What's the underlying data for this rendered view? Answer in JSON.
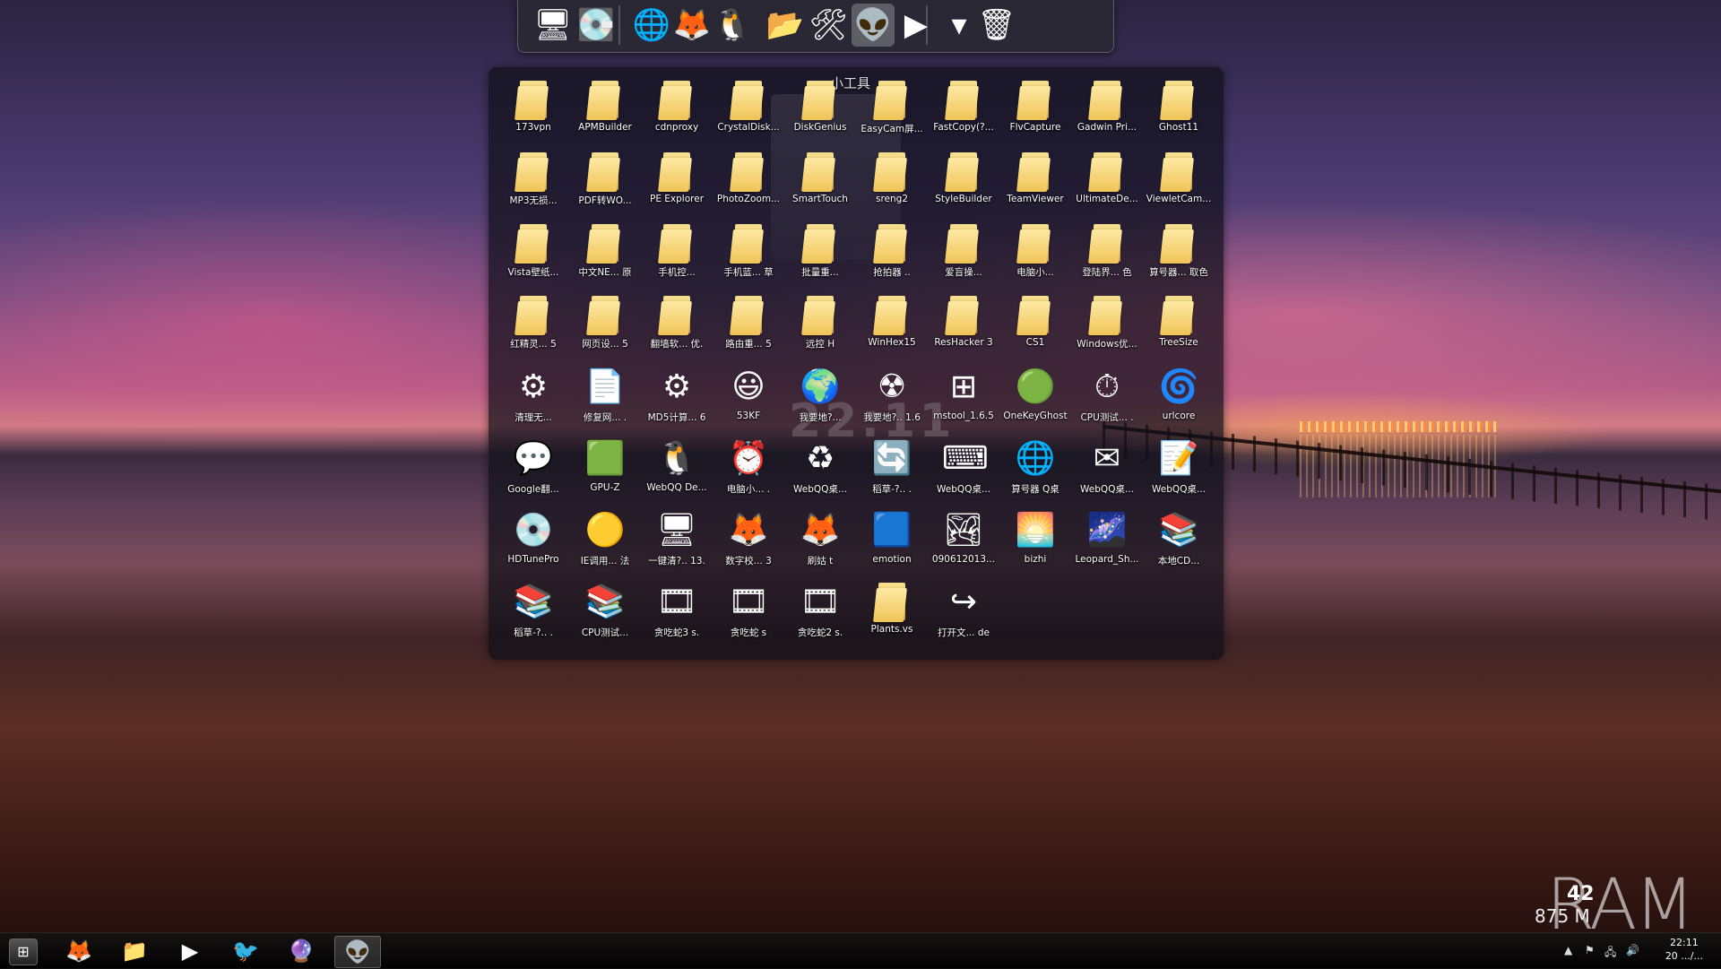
{
  "dock": {
    "items": [
      {
        "name": "computer-icon",
        "glyph": "🖥"
      },
      {
        "name": "disk-cleanup-icon",
        "glyph": "💽"
      },
      {
        "name": "internet-globe-icon",
        "glyph": "🌐"
      },
      {
        "name": "firefox-icon",
        "glyph": "🦊"
      },
      {
        "name": "qq-penguin-icon",
        "glyph": "🐧"
      },
      {
        "name": "download-folder-icon",
        "glyph": "📂"
      },
      {
        "name": "tools-icon",
        "glyph": "🛠"
      },
      {
        "name": "alien-icon",
        "glyph": "👽"
      },
      {
        "name": "media-player-icon",
        "glyph": "▶"
      },
      {
        "name": "dropdown-icon",
        "glyph": "▾"
      },
      {
        "name": "recycle-bin-icon",
        "glyph": "🗑"
      }
    ]
  },
  "panel": {
    "title": "小工具",
    "clock_ghost": "22:11",
    "items": [
      {
        "label": "173vpn",
        "type": "folder"
      },
      {
        "label": "APMBuilder",
        "type": "folder"
      },
      {
        "label": "cdnproxy",
        "type": "folder"
      },
      {
        "label": "CrystalDisk...",
        "type": "folder"
      },
      {
        "label": "DiskGenius",
        "type": "folder"
      },
      {
        "label": "EasyCam屏...",
        "type": "folder"
      },
      {
        "label": "FastCopy(?...",
        "type": "folder"
      },
      {
        "label": "FlvCapture",
        "type": "folder"
      },
      {
        "label": "Gadwin Pri...",
        "type": "folder"
      },
      {
        "label": "Ghost11",
        "type": "folder"
      },
      {
        "label": "MP3无损...",
        "type": "folder"
      },
      {
        "label": "PDF转WO...",
        "type": "folder"
      },
      {
        "label": "PE Explorer",
        "type": "folder"
      },
      {
        "label": "PhotoZoom...",
        "type": "folder"
      },
      {
        "label": "SmartTouch",
        "type": "folder"
      },
      {
        "label": "sreng2",
        "type": "folder"
      },
      {
        "label": "StyleBuilder",
        "type": "folder"
      },
      {
        "label": "TeamViewer",
        "type": "folder"
      },
      {
        "label": "UltimateDe...",
        "type": "folder"
      },
      {
        "label": "ViewletCam...",
        "type": "folder"
      },
      {
        "label": "Vista壁纸...",
        "type": "folder"
      },
      {
        "label": "中文NE... 原",
        "type": "folder"
      },
      {
        "label": "手机控...",
        "type": "folder"
      },
      {
        "label": "手机蓝... 草",
        "type": "folder"
      },
      {
        "label": "批量重...",
        "type": "folder"
      },
      {
        "label": "抢拍器 ..",
        "type": "folder"
      },
      {
        "label": "爱盲操...",
        "type": "folder"
      },
      {
        "label": "电脑小...",
        "type": "folder"
      },
      {
        "label": "登陆界... 色",
        "type": "folder"
      },
      {
        "label": "算号器... 取色",
        "type": "folder"
      },
      {
        "label": "红精灵... 5",
        "type": "folder"
      },
      {
        "label": "网页设... 5",
        "type": "folder"
      },
      {
        "label": "翻墙软... 优.",
        "type": "folder"
      },
      {
        "label": "路由重... 5",
        "type": "folder"
      },
      {
        "label": "远控 H",
        "type": "folder"
      },
      {
        "label": "WinHex15",
        "type": "folder"
      },
      {
        "label": "ResHacker 3",
        "type": "folder"
      },
      {
        "label": "CS1",
        "type": "folder"
      },
      {
        "label": "Windows优...",
        "type": "folder"
      },
      {
        "label": "TreeSize",
        "type": "folder"
      },
      {
        "label": "清理无...",
        "type": "app",
        "icon": "settings-app-icon",
        "glyph": "⚙"
      },
      {
        "label": "修复网... .",
        "type": "app",
        "icon": "document-gear-icon",
        "glyph": "📄"
      },
      {
        "label": "MD5计算... 6",
        "type": "app",
        "icon": "gears-icon",
        "glyph": "⚙"
      },
      {
        "label": "53KF",
        "type": "app",
        "icon": "smiley-icon",
        "glyph": "😃"
      },
      {
        "label": "我要地?...",
        "type": "app",
        "icon": "globe-stand-icon",
        "glyph": "🌍"
      },
      {
        "label": "我要地?.. 1.6",
        "type": "app",
        "icon": "radiation-icon",
        "glyph": "☢"
      },
      {
        "label": "mstool_1.6.5",
        "type": "app",
        "icon": "windows-logo-icon",
        "glyph": "⊞"
      },
      {
        "label": "OneKeyGhost",
        "type": "app",
        "icon": "green-ghost-icon",
        "glyph": "🟢"
      },
      {
        "label": "CPU测试... .",
        "type": "app",
        "icon": "stopwatch-icon",
        "glyph": "⏱"
      },
      {
        "label": "urlcore",
        "type": "app",
        "icon": "blue-swirl-icon",
        "glyph": "🌀"
      },
      {
        "label": "Google翻...",
        "type": "app",
        "icon": "chat-bubbles-icon",
        "glyph": "💬"
      },
      {
        "label": "GPU-Z",
        "type": "app",
        "icon": "graphics-card-icon",
        "glyph": "🟩"
      },
      {
        "label": "WebQQ De...",
        "type": "app",
        "icon": "qq-penguin-icon",
        "glyph": "🐧"
      },
      {
        "label": "电脑小... .",
        "type": "app",
        "icon": "alarm-clock-icon",
        "glyph": "⏰"
      },
      {
        "label": "WebQQ桌...",
        "type": "app",
        "icon": "recycle-icon",
        "glyph": "♻"
      },
      {
        "label": "稻草-?.. .",
        "type": "app",
        "icon": "teamviewer-icon",
        "glyph": "🔄"
      },
      {
        "label": "WebQQ桌...",
        "type": "app",
        "icon": "keyboard-globe-icon",
        "glyph": "⌨"
      },
      {
        "label": "算号器 Q桌",
        "type": "app",
        "icon": "globe-star-icon",
        "glyph": "🌐"
      },
      {
        "label": "WebQQ桌...",
        "type": "app",
        "icon": "envelope-icon",
        "glyph": "✉"
      },
      {
        "label": "WebQQ桌...",
        "type": "app",
        "icon": "notepad-icon",
        "glyph": "📝"
      },
      {
        "label": "HDTunePro",
        "type": "app",
        "icon": "hard-disk-icon",
        "glyph": "💿"
      },
      {
        "label": "IE调用... 法",
        "type": "app",
        "icon": "yellow-ball-icon",
        "glyph": "🟡"
      },
      {
        "label": "一键清?.. 13.",
        "type": "app",
        "icon": "monitor-icon",
        "glyph": "🖥"
      },
      {
        "label": "数字校... 3",
        "type": "app",
        "icon": "firefox-doc-icon",
        "glyph": "🦊"
      },
      {
        "label": "刷姑 t",
        "type": "app",
        "icon": "firefox-doc-icon",
        "glyph": "🦊"
      },
      {
        "label": "emotion",
        "type": "app",
        "icon": "blue-image-icon",
        "glyph": "🟦"
      },
      {
        "label": "090612013...",
        "type": "app",
        "icon": "landscape-image-icon",
        "glyph": "🏞"
      },
      {
        "label": "bizhi",
        "type": "app",
        "icon": "sunset-image-icon",
        "glyph": "🌅"
      },
      {
        "label": "Leopard_Sh...",
        "type": "app",
        "icon": "purple-image-icon",
        "glyph": "🌌"
      },
      {
        "label": "本地CD...",
        "type": "app",
        "icon": "winrar-icon",
        "glyph": "📚"
      },
      {
        "label": "稻草-?.. .",
        "type": "app",
        "icon": "winrar-icon",
        "glyph": "📚"
      },
      {
        "label": "CPU测试...",
        "type": "app",
        "icon": "winrar-icon",
        "glyph": "📚"
      },
      {
        "label": "贪吃蛇3 s.",
        "type": "app",
        "icon": "video-file-icon",
        "glyph": "🎞"
      },
      {
        "label": "贪吃蛇 s",
        "type": "app",
        "icon": "video-file-icon",
        "glyph": "🎞"
      },
      {
        "label": "贪吃蛇2 s.",
        "type": "app",
        "icon": "video-file-icon",
        "glyph": "🎞"
      },
      {
        "label": "Plants.vs",
        "type": "folder"
      },
      {
        "label": "打开文... de",
        "type": "app",
        "icon": "shortcut-arrow-icon",
        "glyph": "↪"
      }
    ]
  },
  "taskbar": {
    "buttons": [
      {
        "name": "firefox-icon",
        "glyph": "🦊"
      },
      {
        "name": "explorer-folder-icon",
        "glyph": "📁"
      },
      {
        "name": "media-player-icon",
        "glyph": "▶"
      },
      {
        "name": "thunderbird-icon",
        "glyph": "🐦"
      },
      {
        "name": "orb-icon",
        "glyph": "🔮"
      },
      {
        "name": "alien-icon",
        "glyph": "👽"
      }
    ],
    "start_glyph": "⊞",
    "tray": {
      "up_arrow": "▲",
      "flag": "⚑",
      "network": "🖧",
      "volume": "🔊"
    },
    "clock_time": "22:11",
    "clock_date": "20 .../..."
  },
  "ram_widget": {
    "label": "RAM",
    "percent": "42",
    "megabytes": "875 M"
  }
}
